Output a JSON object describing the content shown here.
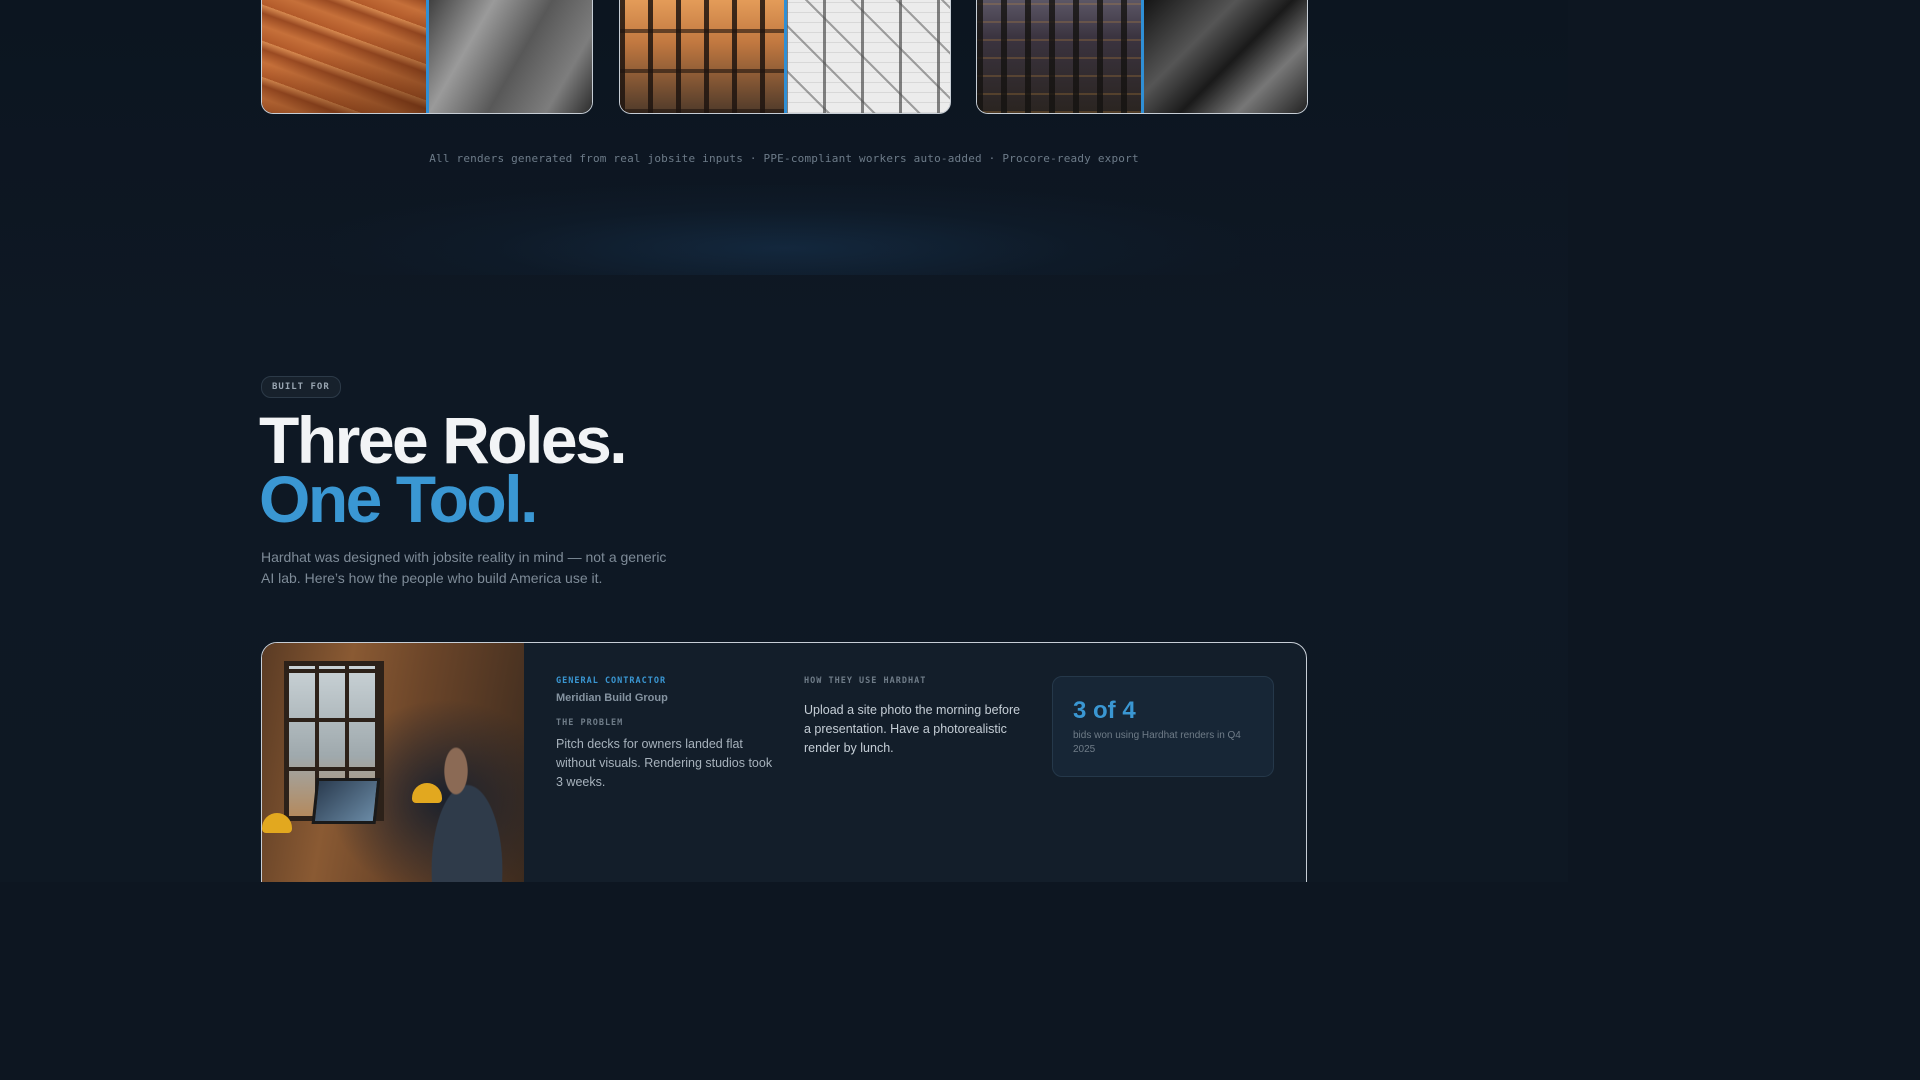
{
  "gallery": {
    "caption": "All renders generated from real jobsite inputs · PPE-compliant workers auto-added · Procore-ready export",
    "cards": [
      {
        "left_image": "excavation-site-photo",
        "right_image": "excavation-render-grayscale"
      },
      {
        "left_image": "steel-frame-sunset-photo",
        "right_image": "steel-frame-sketch-render"
      },
      {
        "left_image": "city-building-construction-photo",
        "right_image": "scaffold-tower-render"
      }
    ]
  },
  "built_for": {
    "badge": "BUILT FOR",
    "headline_line1": "Three Roles.",
    "headline_line2": "One Tool.",
    "lede": "Hardhat was designed with jobsite reality in mind — not a generic AI lab. Here’s how the people who build America use it.",
    "accent_color": "#3a97d3"
  },
  "role_card": {
    "photo": "contractor-at-laptop-photo",
    "role": "GENERAL CONTRACTOR",
    "company": "Meridian Build Group",
    "problem_label": "THE PROBLEM",
    "problem_text": "Pitch decks for owners landed flat without visuals. Rendering studios took 3 weeks.",
    "usage_label": "HOW THEY USE HARDHAT",
    "usage_text": "Upload a site photo the morning before a presentation. Have a photorealistic render by lunch.",
    "stat_value": "3 of 4",
    "stat_desc": "bids won using Hardhat renders in Q4 2025"
  }
}
